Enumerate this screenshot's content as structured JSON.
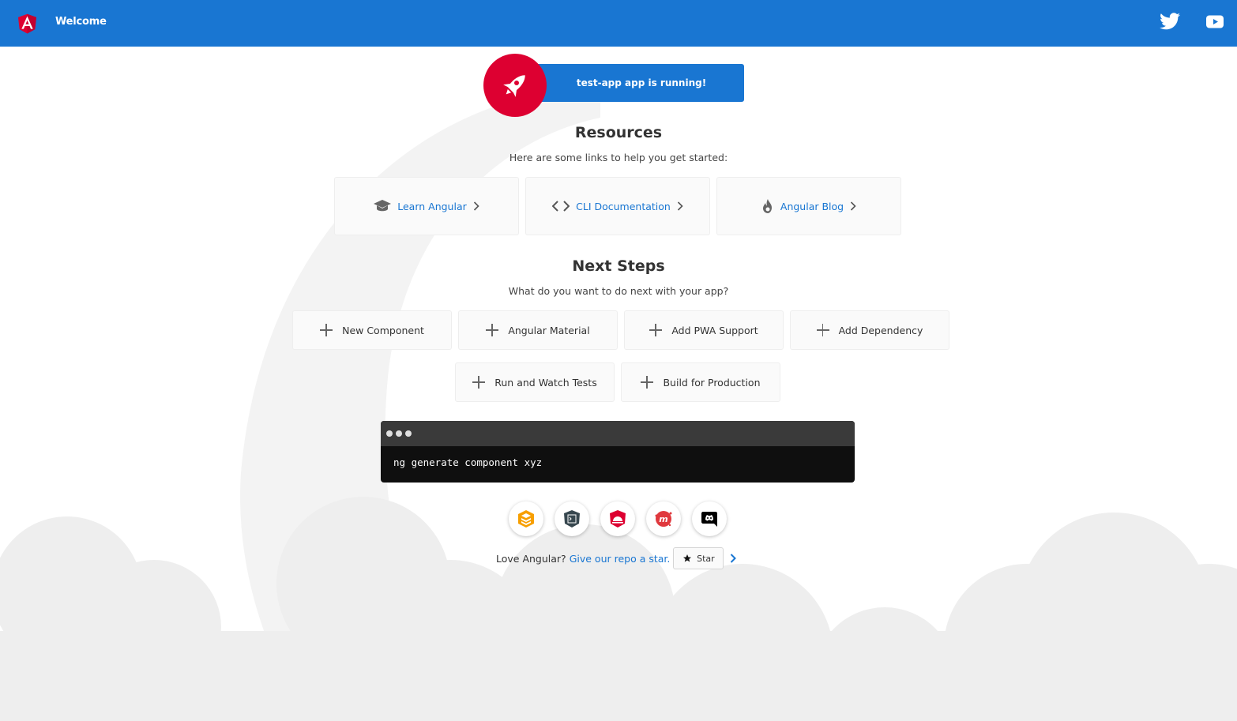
{
  "toolbar": {
    "title": "Welcome",
    "brand_color": "#1976d2",
    "logo_icon": "angular-logo-icon",
    "social": [
      "twitter-icon",
      "youtube-icon"
    ]
  },
  "running": {
    "label": "test-app app is running!",
    "icon": "rocket-icon",
    "accent_color": "#dd0031"
  },
  "resources": {
    "title": "Resources",
    "subtitle": "Here are some links to help you get started:",
    "cards": [
      {
        "label": "Learn Angular",
        "icon": "graduation-cap-icon"
      },
      {
        "label": "CLI Documentation",
        "icon": "code-brackets-icon"
      },
      {
        "label": "Angular Blog",
        "icon": "flame-icon"
      }
    ]
  },
  "next_steps": {
    "title": "Next Steps",
    "subtitle": "What do you want to do next with your app?",
    "cards": [
      {
        "label": "New Component"
      },
      {
        "label": "Angular Material"
      },
      {
        "label": "Add PWA Support"
      },
      {
        "label": "Add Dependency"
      },
      {
        "label": "Run and Watch Tests"
      },
      {
        "label": "Build for Production"
      }
    ]
  },
  "terminal": {
    "command": "ng generate component xyz"
  },
  "community_links": [
    {
      "icon": "animations-icon"
    },
    {
      "icon": "cli-icon"
    },
    {
      "icon": "augury-icon"
    },
    {
      "icon": "meetup-icon"
    },
    {
      "icon": "discord-icon"
    }
  ],
  "footer": {
    "text": "Love Angular?",
    "link": "Give our repo a star.",
    "star_label": "Star"
  }
}
